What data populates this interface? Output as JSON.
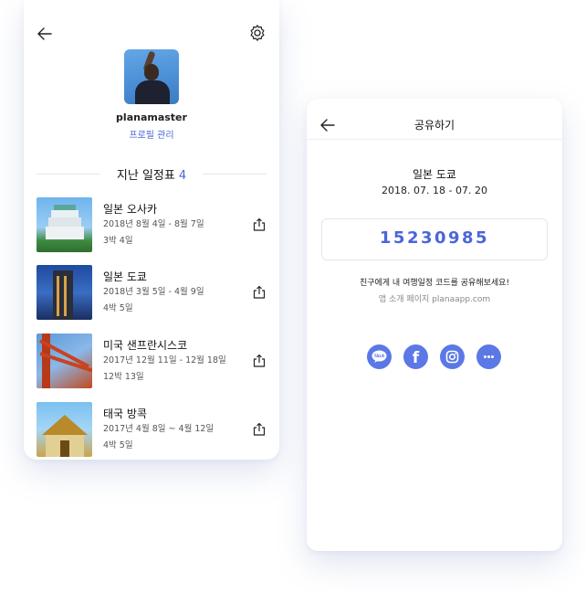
{
  "left_screen": {
    "profile": {
      "username": "planamaster",
      "manage_label": "프로필 관리"
    },
    "section": {
      "title": "지난 일정표",
      "count": "4"
    },
    "trips": [
      {
        "name": "일본 오사카",
        "dates": "2018년 8월 4일 - 8월 7일",
        "nights": "3박 4일",
        "image": "osaka-castle-photo"
      },
      {
        "name": "일본 도쿄",
        "dates": "2018년 3월 5일 - 4월 9일",
        "nights": "4박 5일",
        "image": "tokyo-tower-photo"
      },
      {
        "name": "미국 샌프란시스코",
        "dates": "2017년 12월 11일 - 12월 18일",
        "nights": "12박 13일",
        "image": "golden-gate-photo"
      },
      {
        "name": "태국 방콕",
        "dates": "2017년 4월 8일 ~ 4월 12일",
        "nights": "4박 5일",
        "image": "bangkok-temple-photo"
      }
    ],
    "icons": {
      "back": "arrow-left-icon",
      "settings": "gear-icon",
      "share": "share-icon"
    }
  },
  "right_screen": {
    "title": "공유하기",
    "destination": "일본 도쿄",
    "date_range": "2018. 07. 18 - 07. 20",
    "share_code": "15230985",
    "message": "친구에게 내 여행일정 코드를 공유해보세요!",
    "site_info": "앱 소개 페이지 planaapp.com",
    "social_buttons": [
      {
        "name": "kakaotalk",
        "label": "TALK"
      },
      {
        "name": "facebook",
        "label": "f"
      },
      {
        "name": "instagram",
        "label": ""
      },
      {
        "name": "more",
        "label": ""
      }
    ]
  },
  "colors": {
    "accent": "#4a66d9",
    "social": "#5b78e6",
    "text": "#111111",
    "muted": "#888888"
  }
}
